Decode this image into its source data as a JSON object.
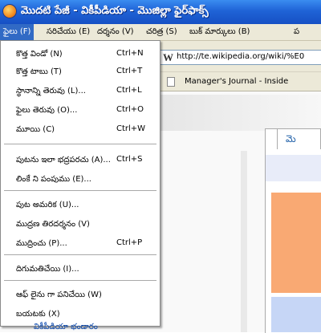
{
  "window": {
    "title": "మొదటి పేజీ - వికీపీడియా - మొజిల్లా ఫైర్‌ఫాక్స్",
    "icon": "firefox-icon"
  },
  "menubar": {
    "items": [
      {
        "label": "ఫైలు (F)",
        "active": true
      },
      {
        "label": "సరిచేయు (E)"
      },
      {
        "label": "దర్శనం (V)"
      },
      {
        "label": "చరిత్ర (S)"
      },
      {
        "label": "బుక్ మార్కులు (B)"
      },
      {
        "label": "ప"
      }
    ]
  },
  "browser": {
    "url": "http://te.wikipedia.org/wiki/%E0",
    "favicon": "W",
    "bookmark": "Manager's Journal - Inside",
    "page_tab": "మె",
    "status_text": "వికీపీడియా భండారం"
  },
  "file_menu": {
    "items": [
      {
        "label": "కొత్త విండో (N)",
        "shortcut": "Ctrl+N"
      },
      {
        "label": "కొత్త టాబు (T)",
        "shortcut": "Ctrl+T"
      },
      {
        "label": "స్థానాన్ని తెరువు (L)...",
        "shortcut": "Ctrl+L"
      },
      {
        "label": "ఫైలు తెరువు (O)...",
        "shortcut": "Ctrl+O"
      },
      {
        "label": "మూయి (C)",
        "shortcut": "Ctrl+W"
      },
      {
        "label": "పుటను ఇలా భద్రపరచు (A)...",
        "shortcut": "Ctrl+S"
      },
      {
        "label": "లింకే ని పంపుము (E)...",
        "shortcut": ""
      },
      {
        "label": "పుట అమరిక (U)...",
        "shortcut": ""
      },
      {
        "label": "ముద్రణ తిరదర్శనం (V)",
        "shortcut": ""
      },
      {
        "label": "ముద్రించు (P)...",
        "shortcut": "Ctrl+P"
      },
      {
        "label": "దిగుమతిచేయి (I)...",
        "shortcut": ""
      },
      {
        "label": "ఆఫ్ లైను గా పనిచేయి (W)",
        "shortcut": ""
      },
      {
        "label": "బయటకు (X)",
        "shortcut": ""
      }
    ]
  },
  "colors": {
    "titlebar": "#1f63d6",
    "menu_highlight": "#316ac5",
    "menu_background": "#ffffff"
  }
}
